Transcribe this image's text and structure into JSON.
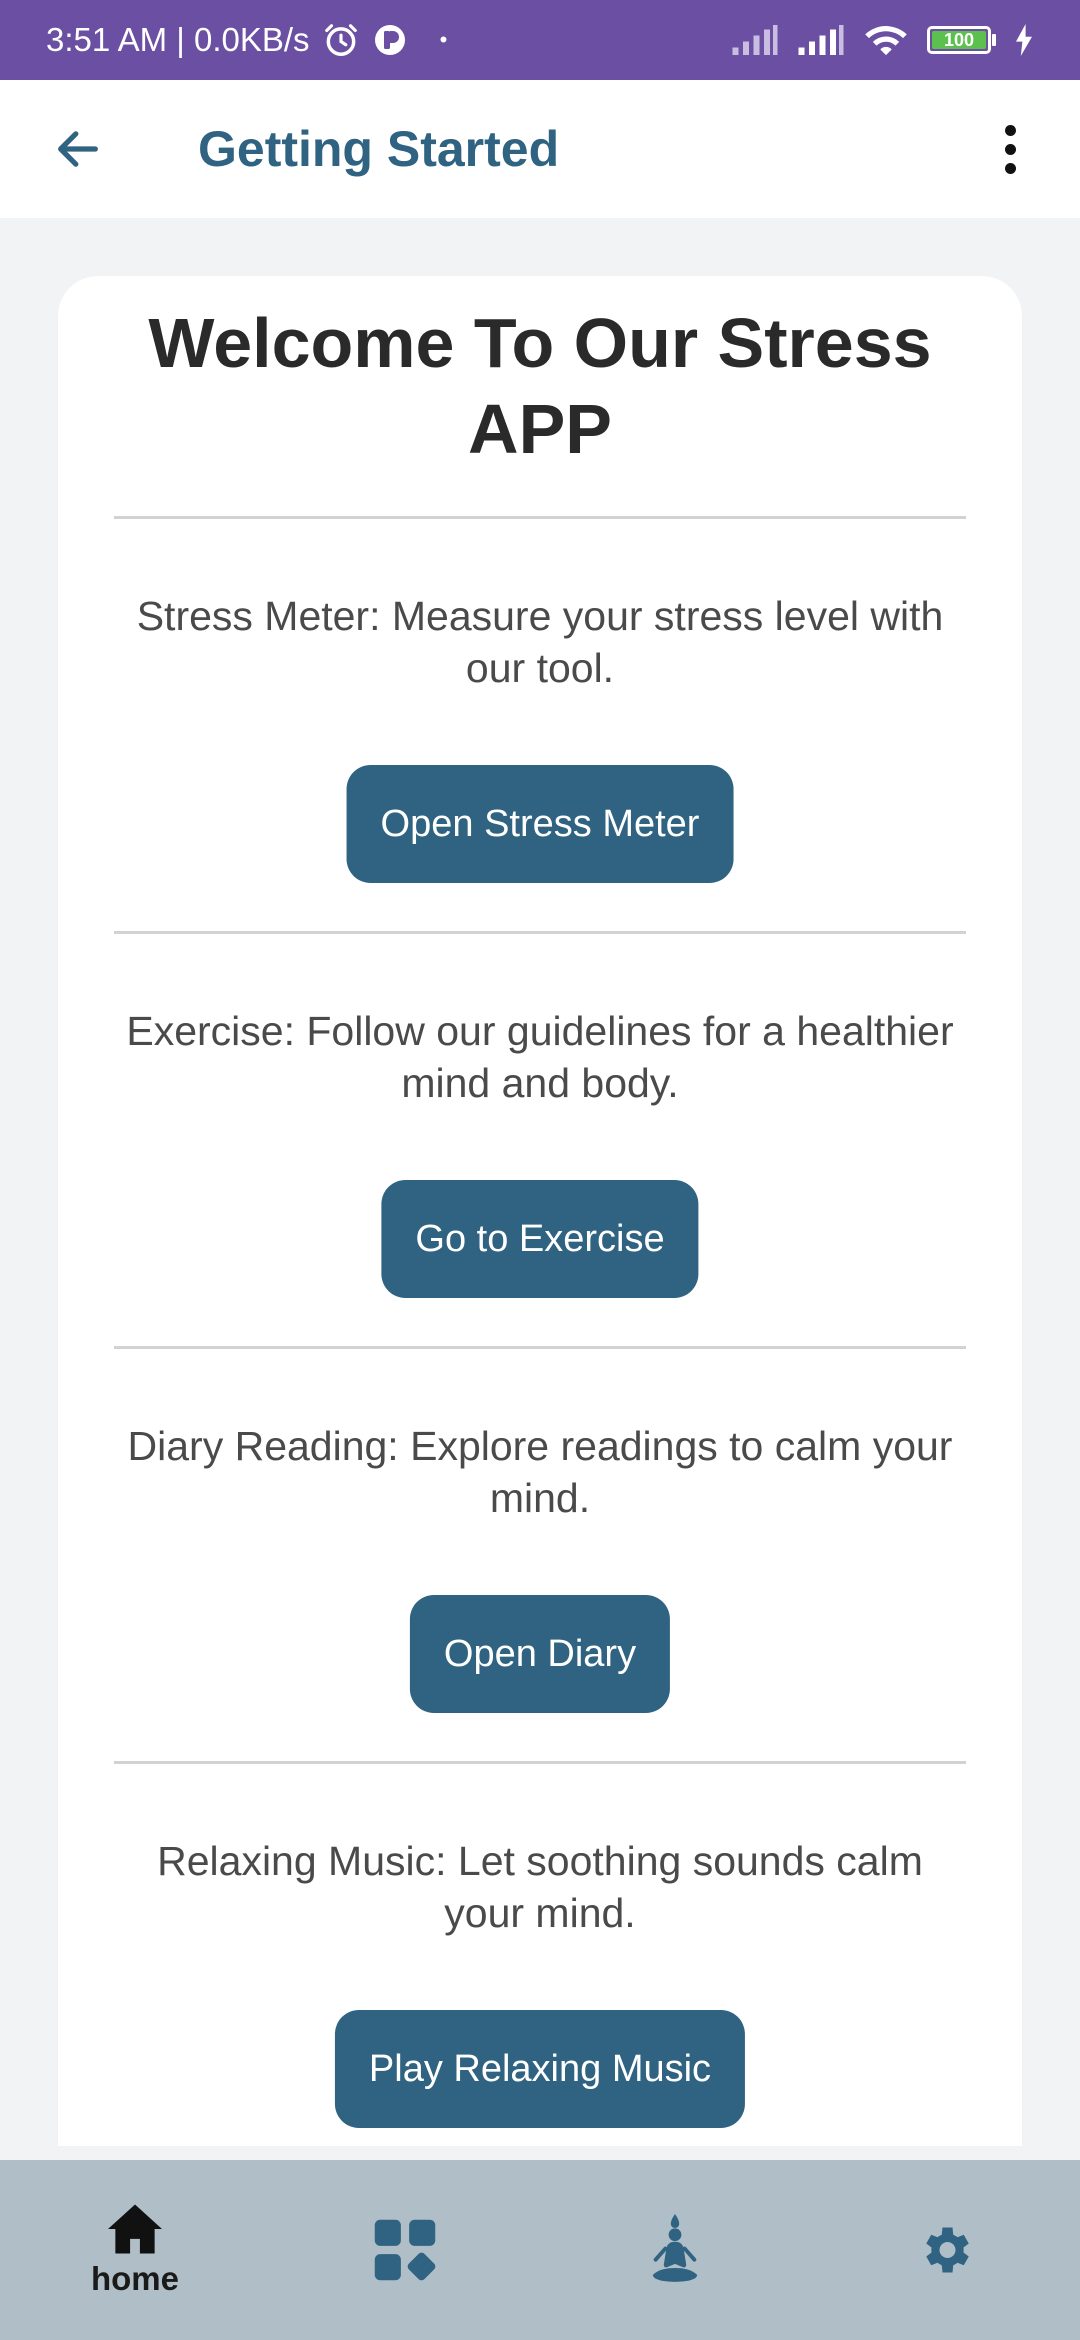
{
  "status_bar": {
    "time_speed": "3:51 AM | 0.0KB/s",
    "dot": "•",
    "battery_level": "100",
    "icons": [
      "alarm-icon",
      "app-indicator-icon",
      "signal-icon",
      "signal-icon",
      "wifi-icon",
      "battery-icon",
      "charging-icon"
    ],
    "background_color": "#6a4fa3"
  },
  "app_bar": {
    "title": "Getting Started",
    "back_icon": "arrow-left-icon",
    "menu_icon": "more-vertical-icon",
    "title_color": "#2f6381"
  },
  "content": {
    "welcome_title": "Welcome To Our Stress APP",
    "sections": [
      {
        "text": "Stress Meter: Measure your stress level with our tool.",
        "button_label": "Open Stress Meter"
      },
      {
        "text": "Exercise: Follow our guidelines for a healthier mind and body.",
        "button_label": "Go to Exercise"
      },
      {
        "text": "Diary Reading: Explore readings to calm your mind.",
        "button_label": "Open Diary"
      },
      {
        "text": "Relaxing Music: Let soothing sounds calm your mind.",
        "button_label": "Play Relaxing Music"
      }
    ],
    "button_color": "#2f6381"
  },
  "bottom_nav": {
    "items": [
      {
        "icon": "home-icon",
        "label": "home",
        "active": true
      },
      {
        "icon": "dashboard-icon",
        "label": "",
        "active": false
      },
      {
        "icon": "meditation-icon",
        "label": "",
        "active": false
      },
      {
        "icon": "settings-icon",
        "label": "",
        "active": false
      }
    ],
    "background_color": "#b0bec7"
  }
}
